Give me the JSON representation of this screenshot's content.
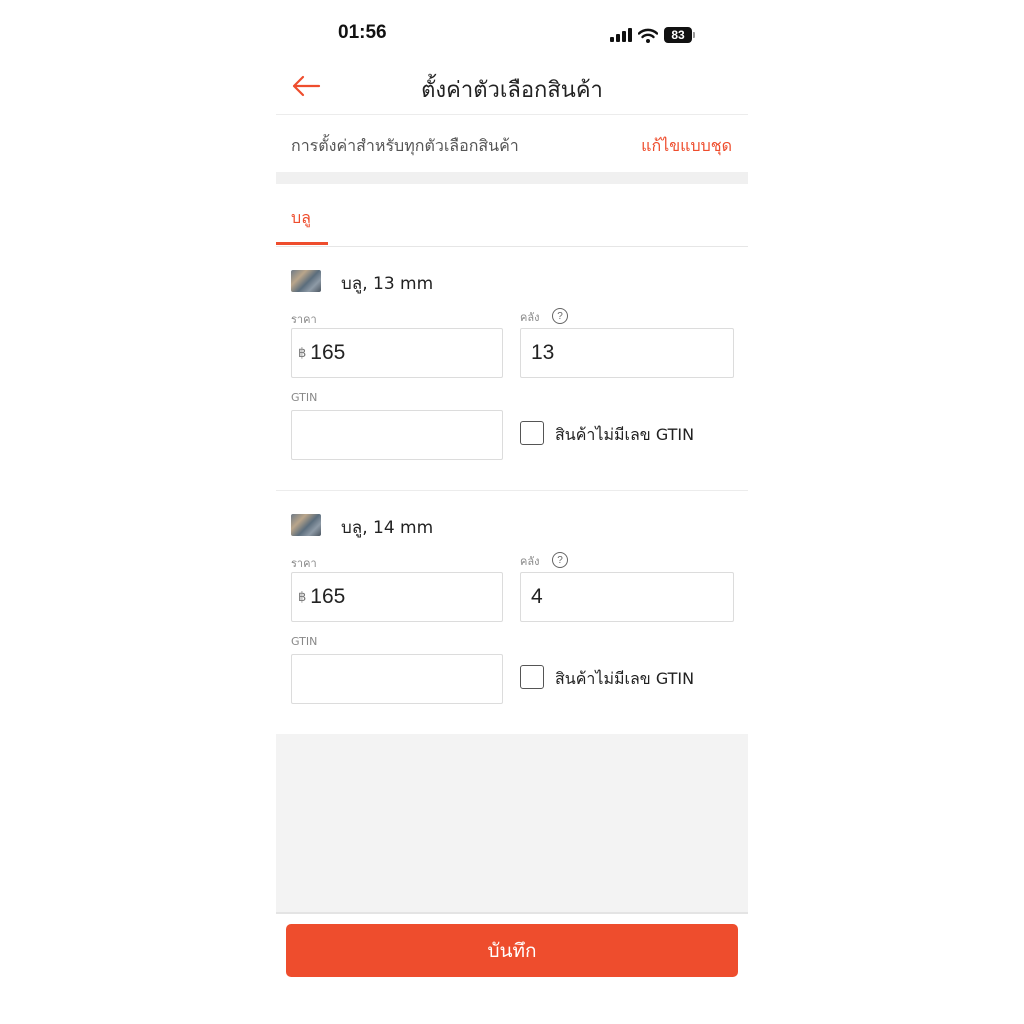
{
  "status_bar": {
    "time": "01:56",
    "battery": "83"
  },
  "header": {
    "title": "ตั้งค่าตัวเลือกสินค้า"
  },
  "settings_row": {
    "label": "การตั้งค่าสำหรับทุกตัวเลือกสินค้า",
    "action_label": "แก้ไขแบบชุด"
  },
  "tabs": [
    {
      "label": "บลู",
      "active": true
    }
  ],
  "variants": [
    {
      "name": "บลู, 13 mm",
      "price_label": "ราคา",
      "currency": "฿",
      "price": "165",
      "stock_label": "คลัง",
      "stock": "13",
      "gtin_label": "GTIN",
      "gtin_value": "",
      "no_gtin_label": "สินค้าไม่มีเลข GTIN",
      "no_gtin_checked": false
    },
    {
      "name": "บลู, 14 mm",
      "price_label": "ราคา",
      "currency": "฿",
      "price": "165",
      "stock_label": "คลัง",
      "stock": "4",
      "gtin_label": "GTIN",
      "gtin_value": "",
      "no_gtin_label": "สินค้าไม่มีเลข GTIN",
      "no_gtin_checked": false
    }
  ],
  "footer": {
    "save_label": "บันทึก"
  },
  "colors": {
    "accent": "#ee4d2d",
    "background": "#ffffff",
    "section_gray": "#f3f3f3"
  }
}
